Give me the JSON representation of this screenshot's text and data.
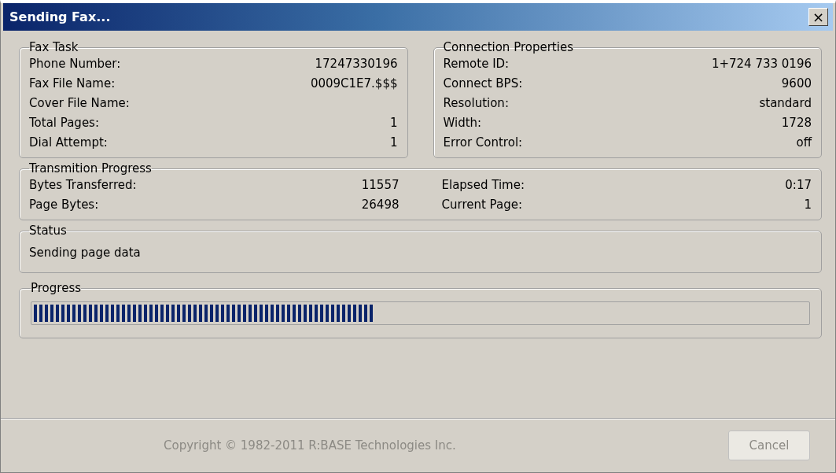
{
  "window": {
    "title": "Sending Fax...",
    "close": "×"
  },
  "fax_task": {
    "title": "Fax Task",
    "fields": [
      {
        "label": "Phone Number:",
        "value": "17247330196"
      },
      {
        "label": "Fax File Name:",
        "value": "0009C1E7.$$$"
      },
      {
        "label": "Cover File Name:"
      },
      {
        "label": "Total Pages:",
        "value": "1"
      },
      {
        "label": "Dial Attempt:",
        "value": "1"
      }
    ]
  },
  "connection": {
    "title": "Connection Properties",
    "fields": [
      {
        "label": "Remote ID:",
        "value": "1+724 733 0196"
      },
      {
        "label": "Connect BPS:",
        "value": "9600"
      },
      {
        "label": "Resolution:",
        "value": "standard"
      },
      {
        "label": "Width:",
        "value": "1728"
      },
      {
        "label": "Error Control:",
        "value": "off"
      }
    ]
  },
  "transmission": {
    "title": "Transmition Progress",
    "columns": [
      [
        {
          "label": "Bytes Transferred:",
          "value": "11557"
        },
        {
          "label": "Page Bytes:",
          "value": "26498"
        }
      ],
      [
        {
          "label": "Elapsed Time:",
          "value": "0:17"
        },
        {
          "label": "Current Page:",
          "value": "1"
        }
      ]
    ]
  },
  "status": {
    "title": "Status",
    "text": "Sending page data"
  },
  "progress": {
    "title": "Progress",
    "level": 0.44
  },
  "footer": {
    "copyright": "Copyright © 1982-2011 R:BASE Technologies Inc.",
    "cancel": {
      "label": "Cancel",
      "disabled": true
    }
  }
}
